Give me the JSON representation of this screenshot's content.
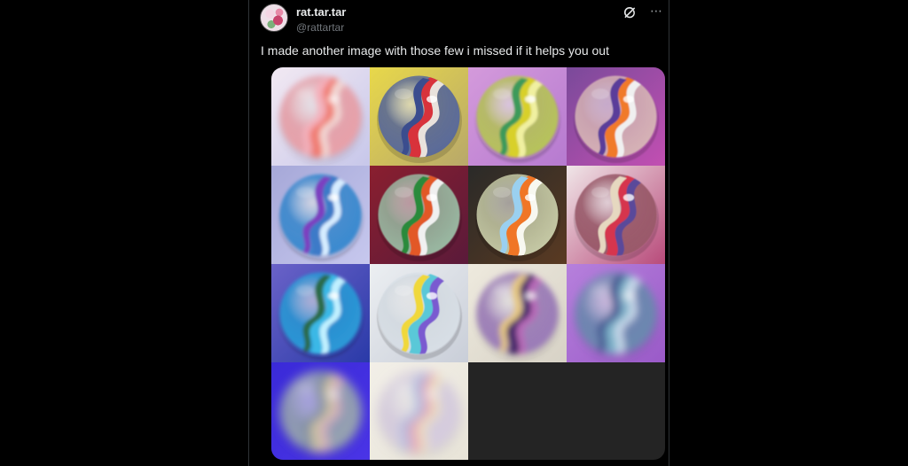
{
  "author": {
    "display_name": "rat.tar.tar",
    "handle": "@rattartar"
  },
  "post": {
    "text": "I made another image with those few i missed if it helps you out"
  },
  "icons": {
    "grok": "grok-icon",
    "more": "more-icon"
  },
  "media": {
    "empty_cell_color": "#242424",
    "marbles": [
      {
        "bg": [
          "#f2e9f2",
          "#c7c7ea"
        ],
        "glass": "#e9a0a8",
        "swirls": [
          "#f07a70",
          "#f4b1bc",
          "#f2d9d6"
        ],
        "blur": 3.5
      },
      {
        "bg": [
          "#e8d84a",
          "#b8a86a"
        ],
        "glass": "#5a6a9a",
        "swirls": [
          "#d8333a",
          "#3a4d8e",
          "#e9e2dc"
        ],
        "blur": 0.2
      },
      {
        "bg": [
          "#d49adb",
          "#b67ad0"
        ],
        "glass": "#b7c45a",
        "swirls": [
          "#d8d02a",
          "#3e9a5a",
          "#f0f0a0"
        ],
        "blur": 1.2
      },
      {
        "bg": [
          "#7a4a9a",
          "#c24fb2"
        ],
        "glass": "#d6b3b6",
        "swirls": [
          "#f07a2a",
          "#5a3c9a",
          "#f0f0f0"
        ],
        "blur": 0.9
      },
      {
        "bg": [
          "#a6a8d8",
          "#c7c8ee"
        ],
        "glass": "#3a8ad0",
        "swirls": [
          "#3e7ac8",
          "#7b3fc0",
          "#d6ecff"
        ],
        "blur": 1.6
      },
      {
        "bg": [
          "#8a1f2f",
          "#5a1a3a"
        ],
        "glass": "#9ab9a2",
        "swirls": [
          "#e25828",
          "#2a8a3a",
          "#f0f0f0"
        ],
        "blur": 0.4
      },
      {
        "bg": [
          "#2a2a28",
          "#5a3a22"
        ],
        "glass": "#c5c9a5",
        "swirls": [
          "#f07628",
          "#9ad0f0",
          "#f8f8f0"
        ],
        "blur": 0.3
      },
      {
        "bg": [
          "#f0e6e8",
          "#b84a7a"
        ],
        "glass": "#9a5a6a",
        "swirls": [
          "#d6364e",
          "#e6d8c0",
          "#5a4a9a"
        ],
        "blur": 0.6
      },
      {
        "bg": [
          "#6a62c8",
          "#2a3aa8"
        ],
        "glass": "#2a9ad8",
        "swirls": [
          "#3ab8e6",
          "#2a6a4a",
          "#c0f0ff"
        ],
        "blur": 1.8
      },
      {
        "bg": [
          "#eceff2",
          "#c9ced8"
        ],
        "glass": "#d8dfe6",
        "swirls": [
          "#5ac8d8",
          "#f0d83a",
          "#7a5ad0"
        ],
        "blur": 0.4
      },
      {
        "bg": [
          "#eeeade",
          "#d7d2c6"
        ],
        "glass": "#9a7ab8",
        "swirls": [
          "#4a2a6a",
          "#e6c880",
          "#b86ab8"
        ],
        "blur": 3.2
      },
      {
        "bg": [
          "#b680dc",
          "#9a5ac8"
        ],
        "glass": "#6a8ab0",
        "swirls": [
          "#7ab0c8",
          "#3a4a8a",
          "#d0e0f0"
        ],
        "blur": 4.5
      },
      {
        "bg": [
          "#3a2ad8",
          "#4a34e6"
        ],
        "glass": "#9aa8b0",
        "swirls": [
          "#c8c0a0",
          "#7a8aa0",
          "#d8b0c0"
        ],
        "blur": 5.5
      },
      {
        "bg": [
          "#f2efe8",
          "#e8e4d8"
        ],
        "glass": "#d6cce0",
        "swirls": [
          "#e6a8b8",
          "#a8b8e0",
          "#f0e6c0"
        ],
        "blur": 6
      }
    ]
  }
}
